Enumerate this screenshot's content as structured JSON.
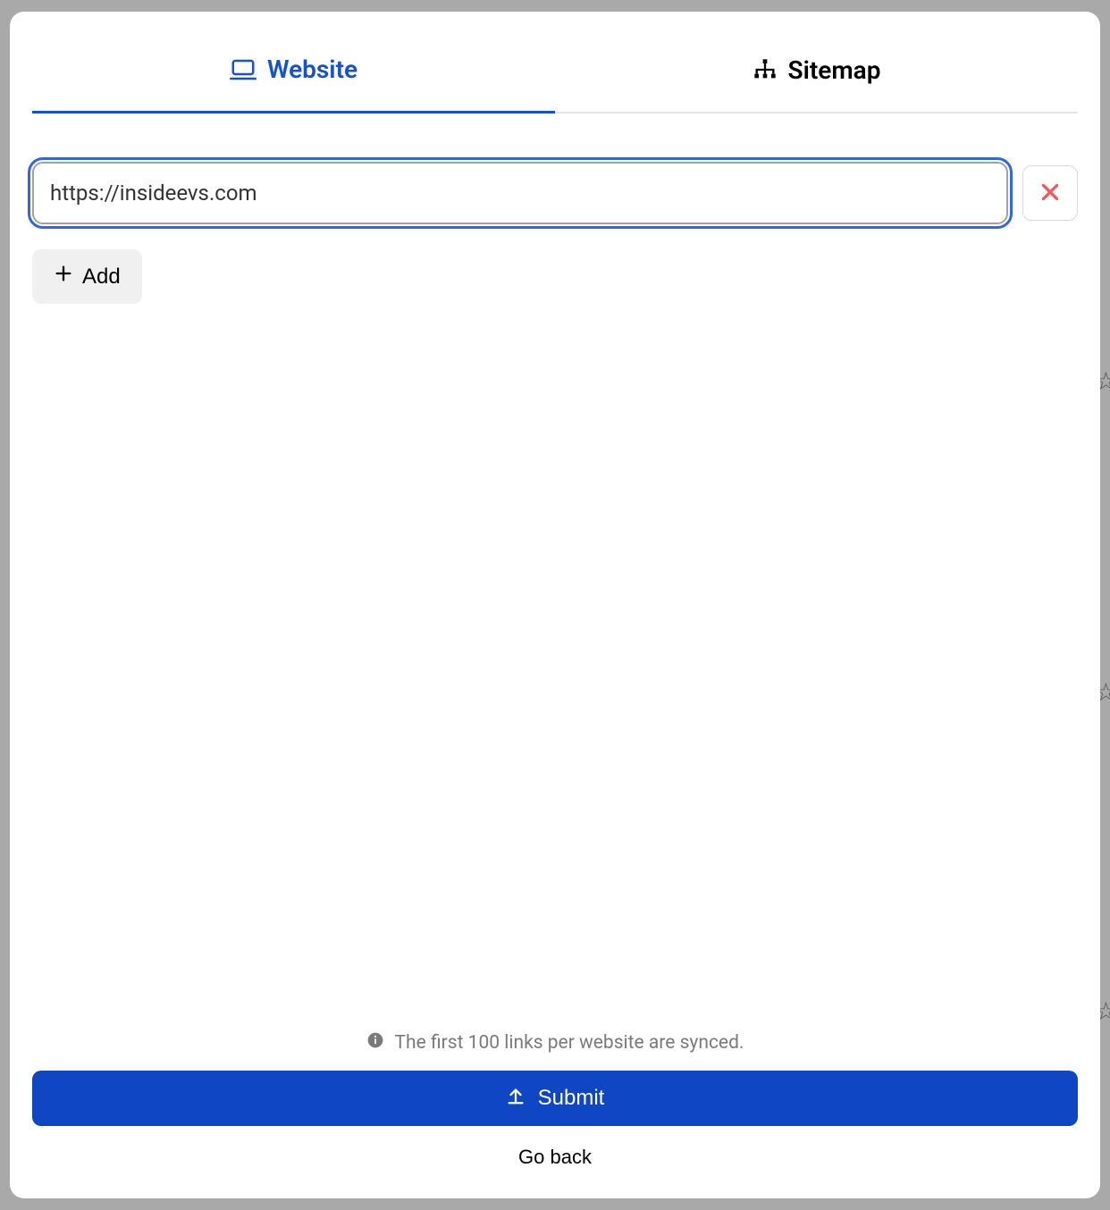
{
  "tabs": {
    "website": {
      "label": "Website"
    },
    "sitemap": {
      "label": "Sitemap"
    }
  },
  "url_field": {
    "value": "https://insideevs.com",
    "placeholder": ""
  },
  "add_button": {
    "label": "Add"
  },
  "info_text": "The first 100 links per website are synced.",
  "submit_button": {
    "label": "Submit"
  },
  "go_back_button": {
    "label": "Go back"
  }
}
